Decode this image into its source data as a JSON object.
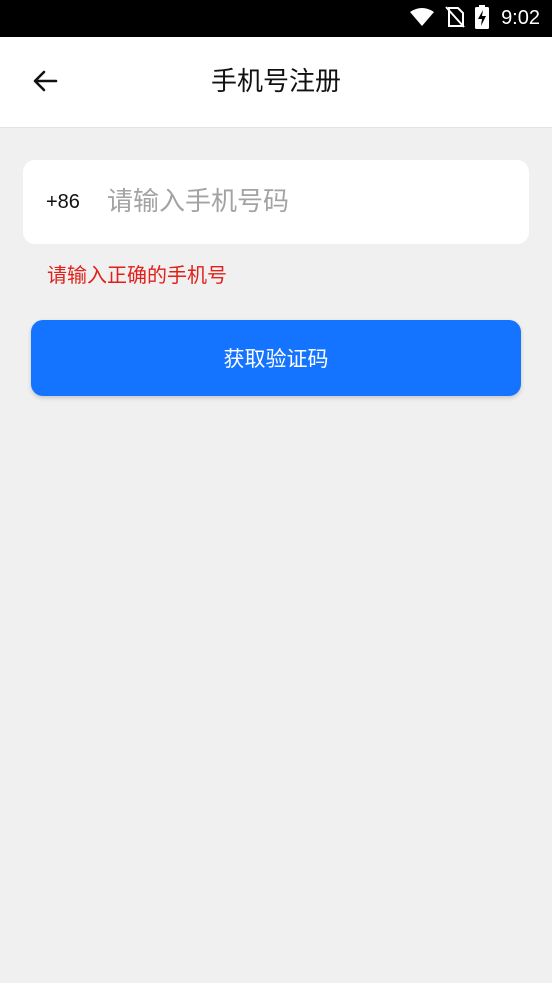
{
  "status_bar": {
    "time": "9:02",
    "icons": [
      "wifi-icon",
      "no-sim-icon",
      "battery-charging-icon"
    ]
  },
  "header": {
    "title": "手机号注册",
    "back_icon": "arrow-left-icon"
  },
  "form": {
    "country_code": "+86",
    "phone_placeholder": "请输入手机号码",
    "phone_value": "",
    "error_message": "请输入正确的手机号",
    "submit_label": "获取验证码"
  },
  "colors": {
    "status_bar_bg": "#000000",
    "page_bg": "#f0f0f0",
    "accent": "#1473ff",
    "error": "#e0201b",
    "placeholder": "#a3a3a3"
  }
}
